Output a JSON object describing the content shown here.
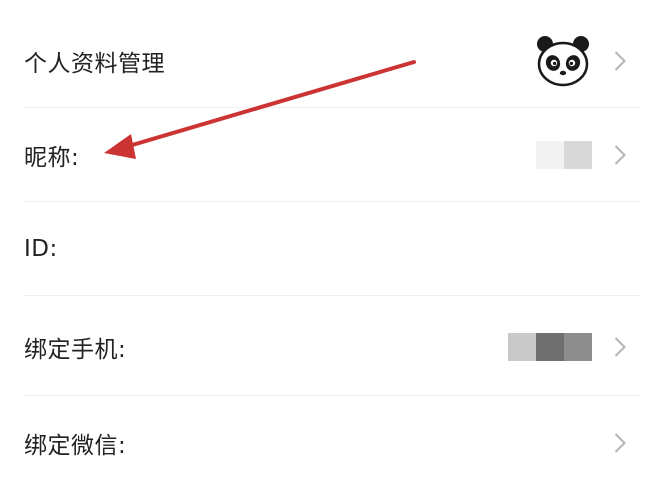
{
  "profile": {
    "header": {
      "label": "个人资料管理",
      "avatar_icon": "panda-avatar-icon"
    },
    "rows": [
      {
        "label": "昵称:",
        "value_masked": true
      },
      {
        "label": "ID:",
        "value_masked": false
      },
      {
        "label": "绑定手机:",
        "value_masked": true
      },
      {
        "label": "绑定微信:",
        "value_masked": false
      }
    ]
  },
  "annotation": {
    "type": "arrow",
    "color": "#cc3333",
    "points_to": "昵称:"
  },
  "colors": {
    "text": "#222222",
    "chevron": "#b5b5b5",
    "divider": "#f0f0f0",
    "mask_light": "#eeeeee",
    "mask_mid": "#d2d2d2",
    "mask_dark": "#8a8a8a"
  }
}
